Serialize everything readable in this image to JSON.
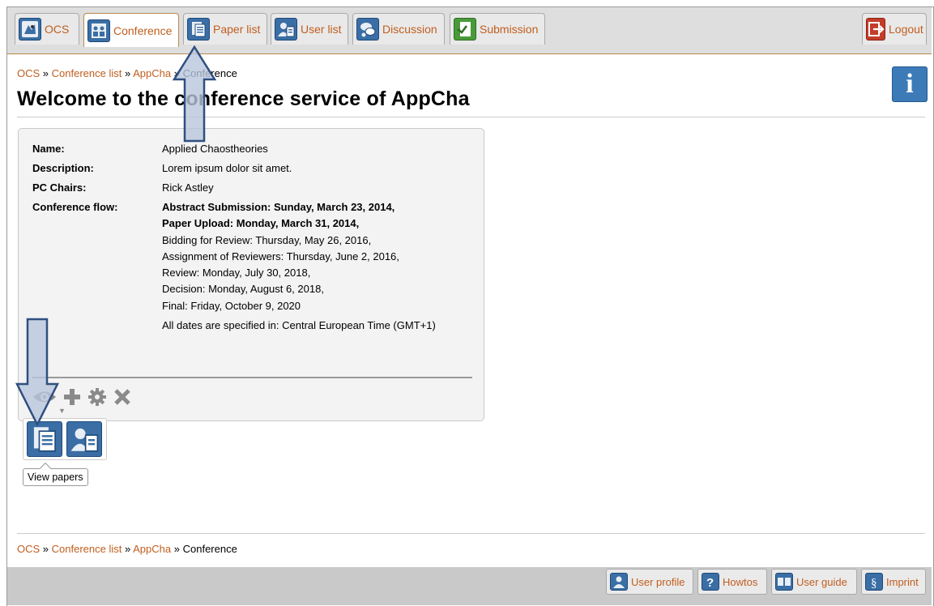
{
  "tabs": [
    {
      "label": "OCS",
      "icon": "ocs-home-icon"
    },
    {
      "label": "Conference",
      "icon": "conference-icon"
    },
    {
      "label": "Paper list",
      "icon": "paper-list-icon"
    },
    {
      "label": "User list",
      "icon": "user-list-icon"
    },
    {
      "label": "Discussion",
      "icon": "discussion-icon"
    },
    {
      "label": "Submission",
      "icon": "submission-icon"
    }
  ],
  "logout_label": "Logout",
  "breadcrumb": {
    "items": [
      "OCS",
      "Conference list",
      "AppCha"
    ],
    "current": "Conference",
    "separator": "»"
  },
  "page_title": "Welcome to the conference service of AppCha",
  "info_glyph": "i",
  "conference": {
    "name_label": "Name:",
    "name": "Applied Chaostheories",
    "description_label": "Description:",
    "description": "Lorem ipsum dolor sit amet.",
    "pc_chairs_label": "PC Chairs:",
    "pc_chairs": "Rick Astley",
    "flow_label": "Conference flow:",
    "flow": [
      {
        "text": "Abstract Submission: Sunday, March 23, 2014,",
        "bold": true
      },
      {
        "text": "Paper Upload: Monday, March 31, 2014,",
        "bold": true
      },
      {
        "text": "Bidding for Review: Thursday, May 26, 2016,",
        "bold": false
      },
      {
        "text": "Assignment of Reviewers: Thursday, June 2, 2016,",
        "bold": false
      },
      {
        "text": "Review: Monday, July 30, 2018,",
        "bold": false
      },
      {
        "text": "Decision: Monday, August 6, 2018,",
        "bold": false
      },
      {
        "text": "Final: Friday, October 9, 2020",
        "bold": false
      }
    ],
    "timezone_note": "All dates are specified in: Central European Time (GMT+1)"
  },
  "actions": {
    "view": "eye-icon",
    "add": "plus-icon",
    "settings": "gear-icon",
    "delete": "close-icon"
  },
  "tooltip": "View papers",
  "footer": {
    "buttons": [
      "User profile",
      "Howtos",
      "User guide",
      "Imprint"
    ]
  },
  "colors": {
    "link": "#c15e1e",
    "icon_blue": "#3a6ea5",
    "arrow_fill": "#b8c7dc",
    "arrow_stroke": "#2f4f80"
  }
}
